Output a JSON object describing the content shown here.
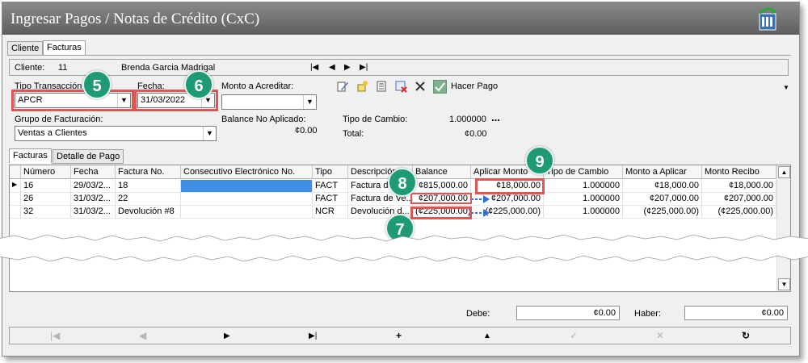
{
  "window": {
    "title": "Ingresar Pagos / Notas de Crédito (CxC)"
  },
  "tabs_top": [
    "Cliente",
    "Facturas"
  ],
  "client": {
    "label": "Cliente:",
    "id": "11",
    "name": "Brenda Garcia Madrigal"
  },
  "record_nav": [
    "|◀",
    "◀",
    "▶",
    "▶|"
  ],
  "form": {
    "tipo_transaccion_label": "Tipo Transacción:",
    "tipo_transaccion_value": "APCR",
    "fecha_label": "Fecha:",
    "fecha_value": "31/03/2022",
    "monto_label": "Monto a Acreditar:",
    "monto_value": "",
    "grupo_label": "Grupo de Facturación:",
    "grupo_value": "Ventas a Clientes",
    "balance_label": "Balance No Aplicado:",
    "balance_value": "¢0.00",
    "tipo_cambio_label": "Tipo de Cambio:",
    "tipo_cambio_value": "1.000000",
    "tipo_cambio_more": "...",
    "total_label": "Total:",
    "total_value": "¢0.00",
    "hacer_pago_label": "Hacer Pago"
  },
  "callouts": [
    "5",
    "6",
    "7",
    "8",
    "9"
  ],
  "grid_tabs": [
    "Facturas",
    "Detalle de Pago"
  ],
  "grid": {
    "columns": [
      "Número",
      "Fecha",
      "Factura No.",
      "Consecutivo Electrónico No.",
      "Tipo",
      "Descripción",
      "Balance",
      "Aplicar Monto",
      "Tipo de Cambio",
      "Monto a Aplicar",
      "Monto Recibo"
    ],
    "rows": [
      {
        "indicator": "▶",
        "numero": "16",
        "fecha": "29/03/2...",
        "factura": "18",
        "consecutivo": "",
        "tipo": "FACT",
        "descripcion": "Factura d...",
        "balance": "¢815,000.00",
        "aplicar": "¢18,000.00",
        "tipo_cambio": "1.000000",
        "monto_aplicar": "¢18,000.00",
        "monto_recibo": "¢18,000.00"
      },
      {
        "indicator": "",
        "numero": "26",
        "fecha": "31/03/2...",
        "factura": "22",
        "consecutivo": "",
        "tipo": "FACT",
        "descripcion": "Factura de Ve...",
        "balance": "¢207,000.00",
        "aplicar": "¢207,000.00",
        "tipo_cambio": "1.000000",
        "monto_aplicar": "¢207,000.00",
        "monto_recibo": "¢207,000.00"
      },
      {
        "indicator": "",
        "numero": "32",
        "fecha": "31/03/2...",
        "factura": "Devolución #8",
        "consecutivo": "",
        "tipo": "NCR",
        "descripcion": "Devolución d...",
        "balance": "(¢225,000.00)",
        "aplicar": "(¢225,000.00)",
        "tipo_cambio": "1.000000",
        "monto_aplicar": "(¢225,000.00)",
        "monto_recibo": "(¢225,000.00)"
      }
    ]
  },
  "totals": {
    "debe_label": "Debe:",
    "debe_value": "¢0.00",
    "haber_label": "Haber:",
    "haber_value": "¢0.00"
  },
  "bottom_nav": [
    "|◀",
    "◀",
    "▶",
    "▶|",
    "+",
    "▲",
    "✓",
    "✕",
    "↻"
  ],
  "colors": {
    "callout": "#1f9a76",
    "highlight": "#e15555",
    "arrow": "#2f6fd6",
    "selected_cell": "#3e8fe6"
  }
}
